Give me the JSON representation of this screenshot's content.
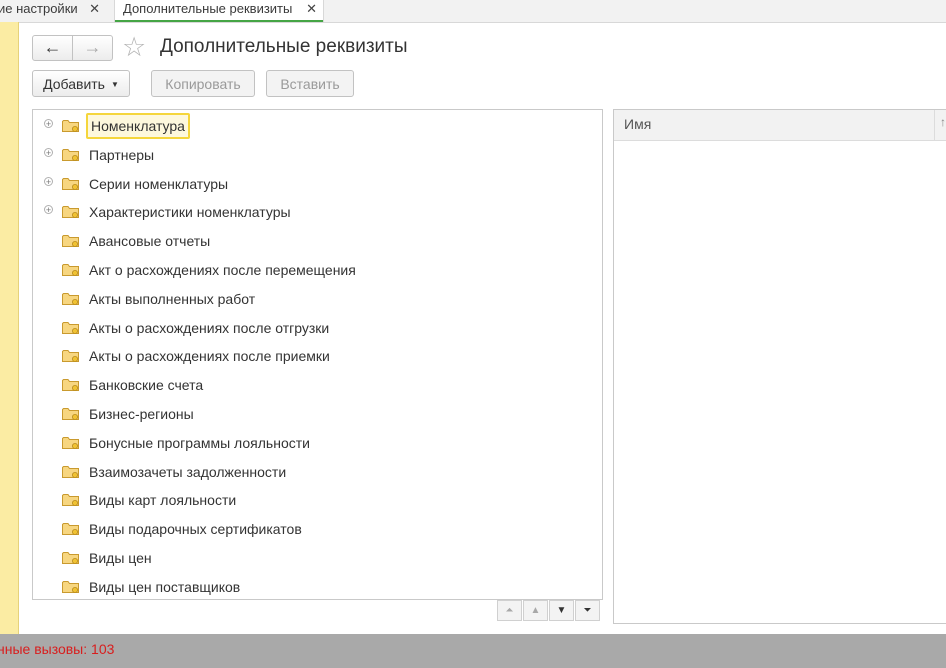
{
  "tabs": [
    {
      "label": "ие настройки",
      "close": "✕"
    },
    {
      "label": "Дополнительные реквизиты",
      "close": "✕"
    }
  ],
  "header": {
    "back_icon": "←",
    "forward_icon": "→",
    "favorite_icon": "☆",
    "title": "Дополнительные реквизиты"
  },
  "toolbar": {
    "add_label": "Добавить",
    "add_caret": "▼",
    "copy_label": "Копировать",
    "paste_label": "Вставить"
  },
  "tree": {
    "selected_index": 0,
    "items": [
      {
        "label": "Номенклатура",
        "expandable": true
      },
      {
        "label": "Партнеры",
        "expandable": true
      },
      {
        "label": "Серии номенклатуры",
        "expandable": true
      },
      {
        "label": "Характеристики номенклатуры",
        "expandable": true
      },
      {
        "label": "Авансовые отчеты",
        "expandable": false
      },
      {
        "label": "Акт о расхождениях после перемещения",
        "expandable": false
      },
      {
        "label": "Акты выполненных работ",
        "expandable": false
      },
      {
        "label": "Акты о расхождениях после отгрузки",
        "expandable": false
      },
      {
        "label": "Акты о расхождениях после приемки",
        "expandable": false
      },
      {
        "label": "Банковские счета",
        "expandable": false
      },
      {
        "label": "Бизнес-регионы",
        "expandable": false
      },
      {
        "label": "Бонусные программы лояльности",
        "expandable": false
      },
      {
        "label": "Взаимозачеты задолженности",
        "expandable": false
      },
      {
        "label": "Виды карт лояльности",
        "expandable": false
      },
      {
        "label": "Виды подарочных сертификатов",
        "expandable": false
      },
      {
        "label": "Виды цен",
        "expandable": false
      },
      {
        "label": "Виды цен поставщиков",
        "expandable": false
      }
    ],
    "footer": {
      "first": "⏶",
      "up": "▲",
      "down": "▼",
      "last": "⏷"
    }
  },
  "right_panel": {
    "column_header": "Имя",
    "column_ellipsis": "↑"
  },
  "status": {
    "text": "нные вызовы: 103"
  },
  "colors": {
    "accent_tab": "#45a545",
    "selection_border": "#f5d63c",
    "status_text": "#d81e1e",
    "left_strip": "#fbeca3"
  }
}
